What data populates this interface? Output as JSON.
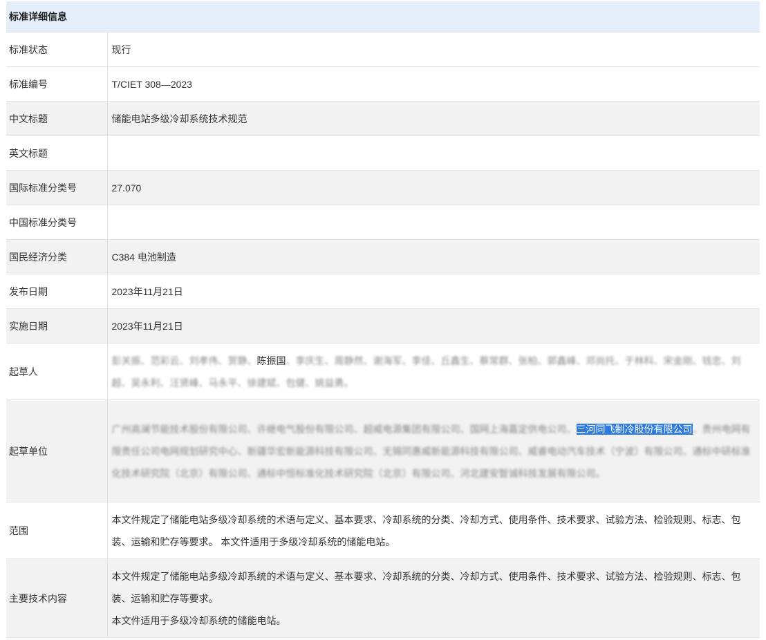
{
  "header": {
    "title": "标准详细信息"
  },
  "rows": [
    {
      "label": "标准状态",
      "value": "现行"
    },
    {
      "label": "标准编号",
      "value": "T/CIET 308—2023"
    },
    {
      "label": "中文标题",
      "value": "储能电站多级冷却系统技术规范"
    },
    {
      "label": "英文标题",
      "value": ""
    },
    {
      "label": "国际标准分类号",
      "value": "27.070"
    },
    {
      "label": "中国标准分类号",
      "value": ""
    },
    {
      "label": "国民经济分类",
      "value": "C384 电池制造"
    },
    {
      "label": "发布日期",
      "value": "2023年11月21日"
    },
    {
      "label": "实施日期",
      "value": "2023年11月21日"
    }
  ],
  "drafters": {
    "label": "起草人",
    "blur_before": "彭关振、范彩云、刘孝伟、贺静、",
    "clear": "陈振国",
    "blur_after": "、李庆生、周静然、谢海军、李佳、丘鑫生、蔡常群、张柏、郭鑫峰、邓尚托、于林科、宋金刚、钱忠、刘超、吴永利、汪贤峰、马永平、徐建斌、包健、姚益勇。"
  },
  "drafting_units": {
    "label": "起草单位",
    "blur_before": "广州高澜节能技术股份有限公司、许继电气股份有限公司、超威电源集团有限公司、国网上海嘉定供电公司、",
    "selected": "三河同飞制冷股份有限公司",
    "blur_after": "、贵州电网有限责任公司电网规划研究中心、新疆华宏新能源科技有限公司、无锡同惠威新能源科技有限公司、威睿电动汽车技术（宁波）有限公司、通标中研标准化技术研究院（北京）有限公司、通标中恒标准化技术研究院（北京）有限公司、河北建安智诚科技发展有限公司。"
  },
  "scope": {
    "label": "范围",
    "value": "本文件规定了储能电站多级冷却系统的术语与定义、基本要求、冷却系统的分类、冷却方式、使用条件、技术要求、试验方法、检验规则、标志、包装、运输和贮存等要求。 本文件适用于多级冷却系统的储能电站。"
  },
  "main_content": {
    "label": "主要技术内容",
    "line1": "本文件规定了储能电站多级冷却系统的术语与定义、基本要求、冷却系统的分类、冷却方式、使用条件、技术要求、试验方法、检验规则、标志、包装、运输和贮存等要求。",
    "line2": "本文件适用于多级冷却系统的储能电站。"
  }
}
